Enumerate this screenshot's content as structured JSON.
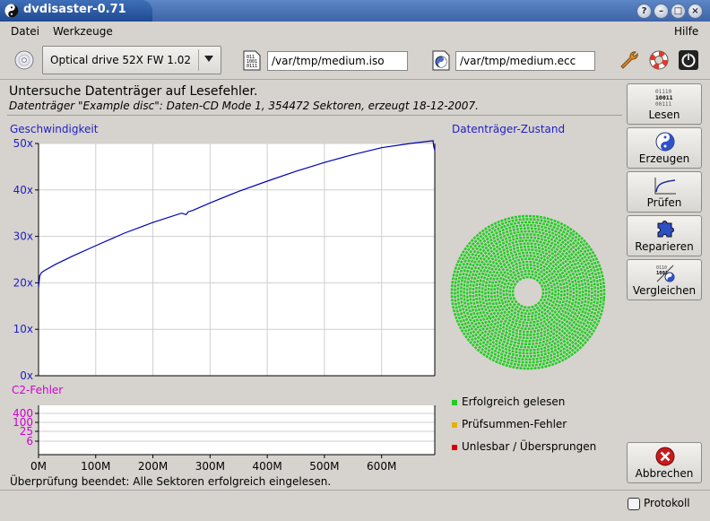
{
  "window": {
    "title": "dvdisaster-0.71"
  },
  "menu": {
    "file": "Datei",
    "tools": "Werkzeuge",
    "help": "Hilfe"
  },
  "toolbar": {
    "drive": "Optical drive 52X FW 1.02",
    "image_path": "/var/tmp/medium.iso",
    "ecc_path": "/var/tmp/medium.ecc",
    "icons": [
      "cd-icon",
      "iso-file-icon",
      "ecc-file-icon",
      "wrench-icon",
      "lifebuoy-icon",
      "power-icon"
    ]
  },
  "status": {
    "headline": "Untersuche Datenträger auf Lesefehler.",
    "subline": "Datenträger \"Example disc\": Daten-CD Mode 1, 354472 Sektoren, erzeugt 18-12-2007.",
    "footer": "Überprüfung beendet: Alle Sektoren erfolgreich eingelesen."
  },
  "sidebar": {
    "buttons": [
      {
        "label": "Lesen",
        "icon": "binary-read-icon"
      },
      {
        "label": "Erzeugen",
        "icon": "yin-yang-icon"
      },
      {
        "label": "Prüfen",
        "icon": "curve-check-icon"
      },
      {
        "label": "Reparieren",
        "icon": "puzzle-icon"
      },
      {
        "label": "Vergleichen",
        "icon": "compare-icon"
      }
    ],
    "abort": {
      "label": "Abbrechen",
      "icon": "abort-icon"
    }
  },
  "protocol": {
    "label": "Protokoll"
  },
  "colors": {
    "speed": "#0000b8",
    "c2": "#d000d0",
    "good": "#22cc22",
    "checksum": "#e8b000",
    "unreadable": "#dd0000",
    "title_blue": "#1e1ec8"
  },
  "chart_data": [
    {
      "type": "line",
      "title": "Geschwindigkeit",
      "xlabel": "",
      "ylabel": "",
      "ylim": [
        0,
        50
      ],
      "xlim": [
        0,
        693
      ],
      "y_ticks": [
        "0x",
        "10x",
        "20x",
        "30x",
        "40x",
        "50x"
      ],
      "x_ticks": [
        "0M",
        "100M",
        "200M",
        "300M",
        "400M",
        "500M",
        "600M"
      ],
      "grid": true,
      "series": [
        {
          "x": [
            0,
            2,
            5,
            10,
            30,
            60,
            100,
            150,
            200,
            250,
            258,
            262,
            270,
            300,
            350,
            400,
            450,
            500,
            550,
            600,
            650,
            690,
            691,
            693
          ],
          "values": [
            19,
            21.5,
            22.2,
            22.6,
            24,
            25.8,
            28,
            30.7,
            33,
            35,
            34.7,
            35.3,
            35.6,
            37.2,
            39.7,
            41.9,
            44,
            45.9,
            47.6,
            49.1,
            50,
            50.6,
            49.5,
            48.5
          ]
        }
      ]
    },
    {
      "type": "line",
      "title": "C2-Fehler",
      "y_ticks": [
        "400",
        "100",
        "25",
        "6"
      ],
      "x_ticks": [
        "0M",
        "100M",
        "200M",
        "300M",
        "400M",
        "500M",
        "600M"
      ],
      "yscale": "log",
      "grid": true,
      "series": []
    },
    {
      "type": "heatmap",
      "title": "Datenträger-Zustand",
      "legend": [
        {
          "label": "Erfolgreich gelesen",
          "color": "#22cc22",
          "value": 100
        },
        {
          "label": "Prüfsummen-Fehler",
          "color": "#e8b000",
          "value": 0
        },
        {
          "label": "Unlesbar / Übersprungen",
          "color": "#dd0000",
          "value": 0
        }
      ]
    }
  ]
}
